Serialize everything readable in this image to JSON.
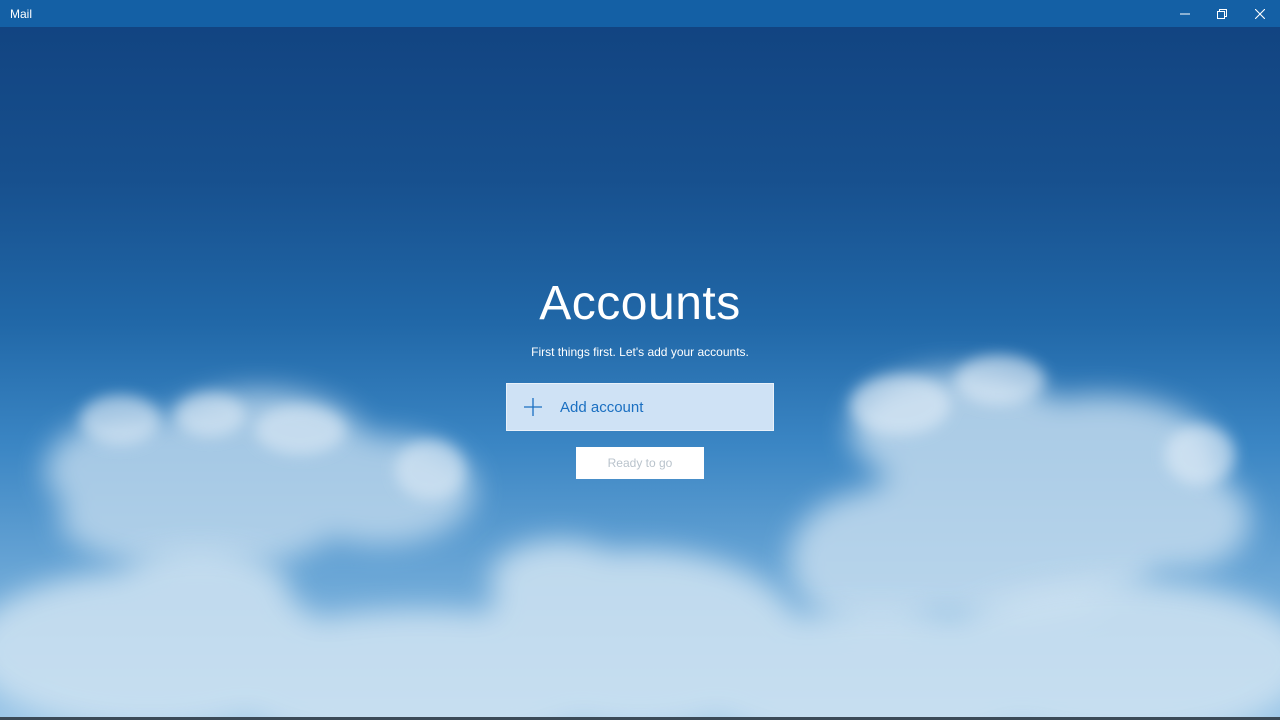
{
  "app": {
    "title": "Mail"
  },
  "window_controls": {
    "minimize": "minimize-icon",
    "restore": "restore-icon",
    "close": "close-icon"
  },
  "main": {
    "heading": "Accounts",
    "subtitle": "First things first. Let's add your accounts.",
    "add_account_label": "Add account",
    "add_account_icon": "plus-icon",
    "ready_label": "Ready to go",
    "ready_enabled": false
  },
  "colors": {
    "titlebar": "#1460a5",
    "accent": "#1a6fc1",
    "add_account_bg": "#cfe2f5",
    "ready_text_disabled": "#b9c3cc"
  }
}
